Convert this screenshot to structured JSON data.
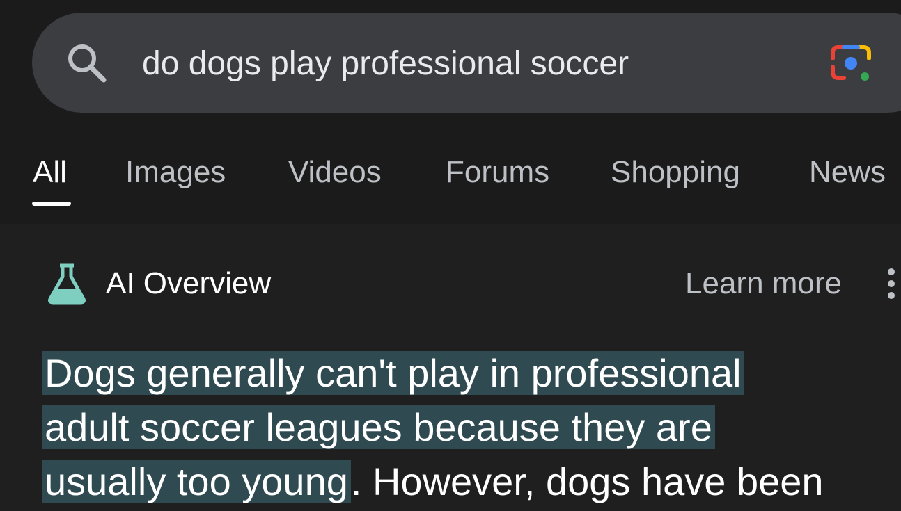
{
  "search": {
    "query": "do dogs play professional soccer"
  },
  "tabs": [
    {
      "label": "All",
      "active": true
    },
    {
      "label": "Images",
      "active": false
    },
    {
      "label": "Videos",
      "active": false
    },
    {
      "label": "Forums",
      "active": false
    },
    {
      "label": "Shopping",
      "active": false
    },
    {
      "label": "News",
      "active": false
    }
  ],
  "ai_overview": {
    "title": "AI Overview",
    "learn_more": "Learn more",
    "lines": [
      {
        "highlighted": "Dogs generally can't play in professional",
        "rest": ""
      },
      {
        "highlighted": "adult soccer leagues because they are",
        "rest": ""
      },
      {
        "highlighted": "usually too young",
        "rest": ". However, dogs have been"
      }
    ]
  },
  "colors": {
    "background": "#1f1f1f",
    "search_bar": "#3c3d41",
    "highlight": "#2f4a50",
    "flask": "#7fcfc0"
  },
  "icons": [
    "search-icon",
    "google-lens-icon",
    "flask-icon",
    "more-vert-icon"
  ]
}
